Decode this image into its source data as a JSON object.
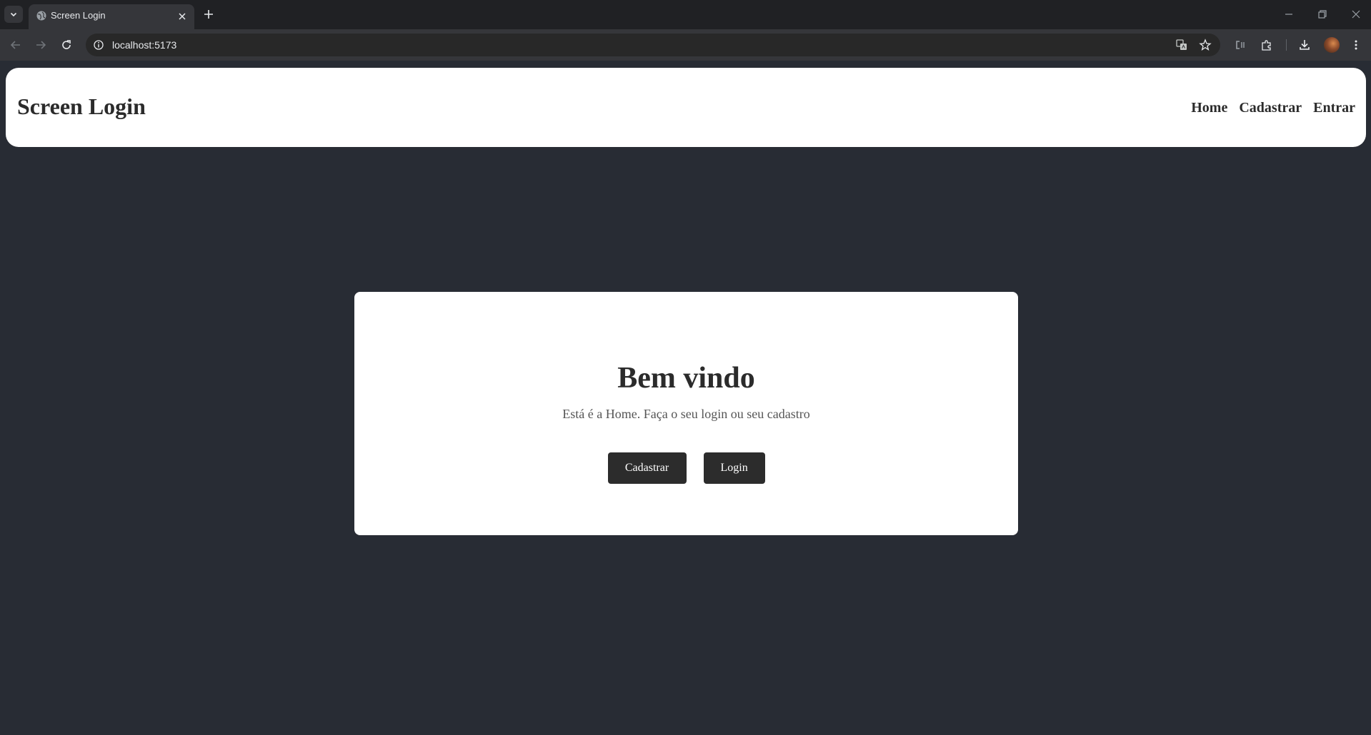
{
  "browser": {
    "tab_title": "Screen Login",
    "url": "localhost:5173"
  },
  "navbar": {
    "brand": "Screen Login",
    "links": [
      "Home",
      "Cadastrar",
      "Entrar"
    ]
  },
  "card": {
    "title": "Bem vindo",
    "subtitle": "Está é a Home. Faça o seu login ou seu cadastro",
    "buttons": [
      "Cadastrar",
      "Login"
    ]
  },
  "colors": {
    "page_background": "#282c34",
    "surface": "#ffffff",
    "button": "#2c2c2c",
    "text": "#2b2b2b"
  }
}
